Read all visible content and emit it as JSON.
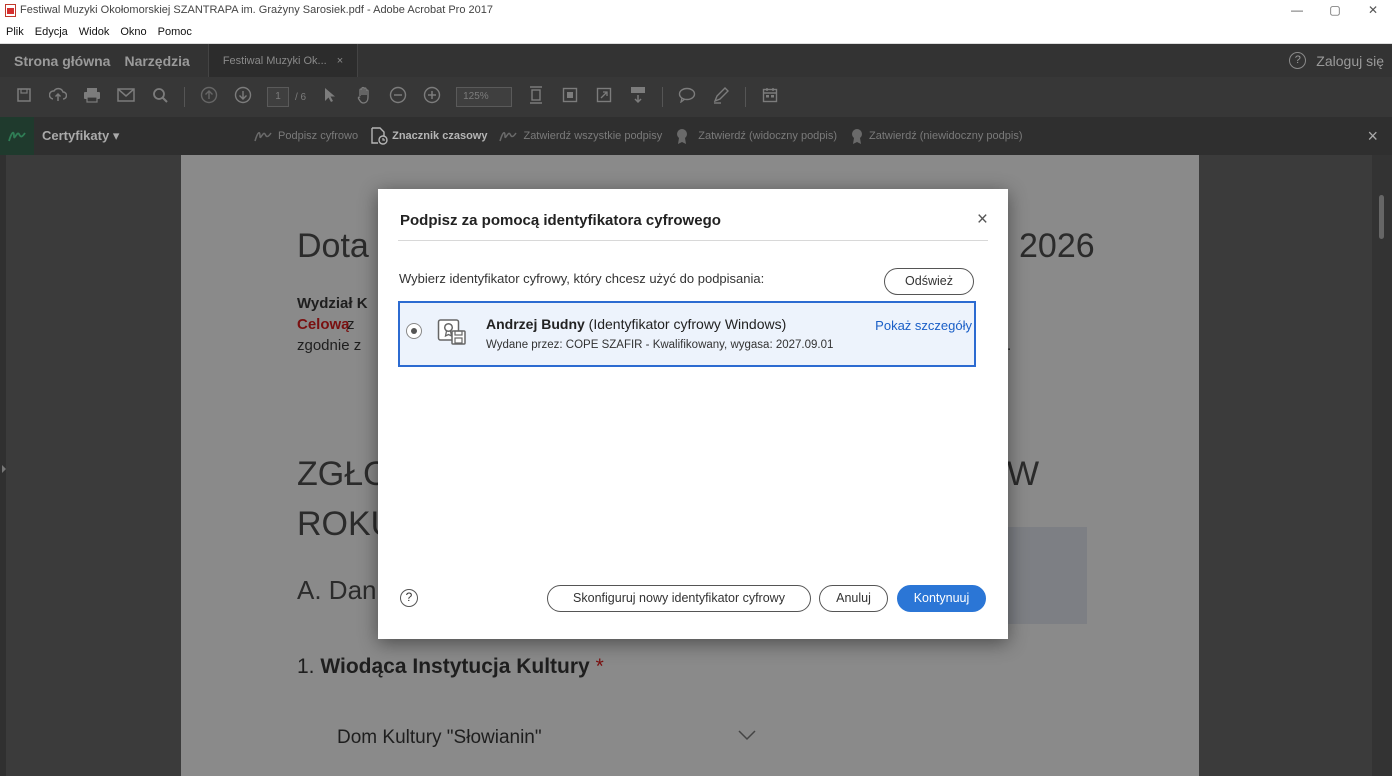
{
  "window": {
    "title": "Festiwal Muzyki Okołomorskiej SZANTRAPA im. Grażyny Sarosiek.pdf - Adobe Acrobat Pro 2017",
    "minimize": "—",
    "restore": "▢",
    "close": "✕"
  },
  "menu": [
    "Plik",
    "Edycja",
    "Widok",
    "Okno",
    "Pomoc"
  ],
  "tabs": {
    "home": "Strona główna",
    "tools": "Narzędzia",
    "doc": "Festiwal Muzyki Ok...",
    "doc_close": "×",
    "help": "?",
    "login": "Zaloguj się"
  },
  "toolbar": {
    "page_current": "1",
    "page_total": "/ 6",
    "zoom": "125%"
  },
  "certbar": {
    "label": "Certyfikaty",
    "actions": [
      "Podpisz cyfrowo",
      "Znacznik czasowy",
      "Zatwierdź wszystkie podpisy",
      "Zatwierdź (widoczny podpis)",
      "Zatwierdź (niewidoczny podpis)"
    ],
    "close": "×"
  },
  "document": {
    "title_left": "Dota",
    "title_right": "2026",
    "dept": "Wydział K",
    "celowa": "Celową",
    "celowa_rest": "z",
    "zgodnie": "zgodnie z",
    "trail_right": ".",
    "heading1_left": "ZGŁO",
    "heading1_right": "W",
    "heading2": "ROKU",
    "section_a": "A. Dan",
    "field1_number": "1.",
    "field1_label": "Wiodąca Instytucja Kultury",
    "field1_required": "*",
    "field1_value": "Dom Kultury \"Słowianin\""
  },
  "dialog": {
    "title": "Podpisz za pomocą identyfikatora cyfrowego",
    "close": "×",
    "prompt": "Wybierz identyfikator cyfrowy, który chcesz użyć do podpisania:",
    "refresh": "Odśwież",
    "id": {
      "name": "Andrzej Budny",
      "type": "(Identyfikator cyfrowy Windows)",
      "issuer": "Wydane przez: COPE SZAFIR - Kwalifikowany, wygasa: 2027.09.01",
      "details": "Pokaż szczegóły"
    },
    "help": "?",
    "configure": "Skonfiguruj nowy identyfikator cyfrowy",
    "cancel": "Anuluj",
    "continue": "Kontynuuj"
  },
  "colors": {
    "accent": "#2b76d6",
    "selection_border": "#2c6bd1",
    "selection_bg": "#edf3fc",
    "link": "#1a5fc7",
    "required": "#7a1010"
  }
}
